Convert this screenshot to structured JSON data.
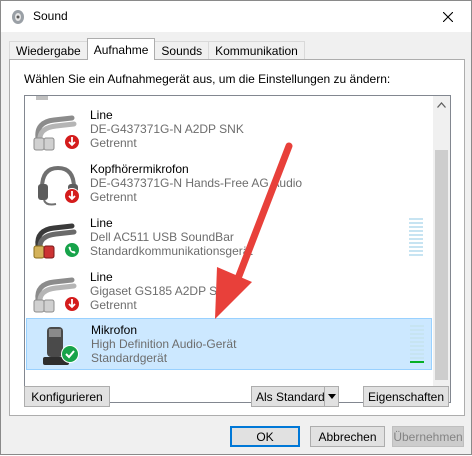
{
  "window": {
    "title": "Sound",
    "close_icon": "close-icon",
    "app_icon": "sound-app-icon"
  },
  "tabs": [
    {
      "label": "Wiedergabe",
      "active": false
    },
    {
      "label": "Aufnahme",
      "active": true
    },
    {
      "label": "Sounds",
      "active": false
    },
    {
      "label": "Kommunikation",
      "active": false
    }
  ],
  "panel": {
    "instruction": "Wählen Sie ein Aufnahmegerät aus, um die Einstellungen zu ändern:"
  },
  "devices": [
    {
      "name": "Line",
      "description": "DE-G437371G-N A2DP SNK",
      "status": "Getrennt",
      "icon": "line-in-cable-icon",
      "badge": "disconnected-badge-icon",
      "selected": false
    },
    {
      "name": "Kopfhörermikrofon",
      "description": "DE-G437371G-N Hands-Free AG Audio",
      "status": "Getrennt",
      "icon": "headset-icon",
      "badge": "disconnected-badge-icon",
      "selected": false
    },
    {
      "name": "Line",
      "description": "Dell AC511 USB SoundBar",
      "status": "Standardkommunikationsgerät",
      "icon": "line-in-cable-icon",
      "badge": "default-communication-badge-icon",
      "selected": false,
      "level": 0
    },
    {
      "name": "Line",
      "description": "Gigaset GS185 A2DP SNK",
      "status": "Getrennt",
      "icon": "line-in-cable-icon",
      "badge": "disconnected-badge-icon",
      "selected": false
    },
    {
      "name": "Mikrofon",
      "description": "High Definition Audio-Gerät",
      "status": "Standardgerät",
      "icon": "microphone-icon",
      "badge": "default-device-badge-icon",
      "selected": true,
      "level": 0.1
    }
  ],
  "buttons": {
    "configure": "Konfigurieren",
    "set_default": "Als Standard",
    "properties": "Eigenschaften",
    "ok": "OK",
    "cancel": "Abbrechen",
    "apply": "Übernehmen"
  },
  "colors": {
    "selection": "#cce8ff",
    "meter_idle": "#c7e4f2",
    "meter_active": "#06b025",
    "annotation_arrow": "#e8403a",
    "disconnected_badge": "#d41c1c",
    "default_badge": "#17a34a"
  }
}
